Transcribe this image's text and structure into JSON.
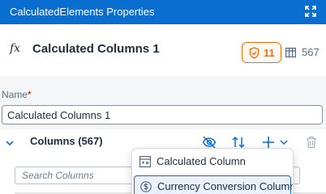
{
  "window": {
    "title": "CalculatedElements Properties"
  },
  "header": {
    "icon": "fx-icon",
    "element_name": "Calculated Columns 1",
    "badge_count": "11",
    "column_count": "567"
  },
  "form": {
    "name_label": "Name",
    "required_mark": "*",
    "name_value": "Calculated Columns 1"
  },
  "columns_section": {
    "title": "Columns (567)",
    "search_placeholder": "Search Columns"
  },
  "add_menu": {
    "items": [
      {
        "label": "Calculated Column",
        "icon": "calculated-column-icon"
      },
      {
        "label": "Currency Conversion Column",
        "icon": "currency-icon"
      }
    ]
  },
  "colors": {
    "accent": "#0a6ed1",
    "warning": "#e9730c",
    "required": "#bb0000"
  }
}
